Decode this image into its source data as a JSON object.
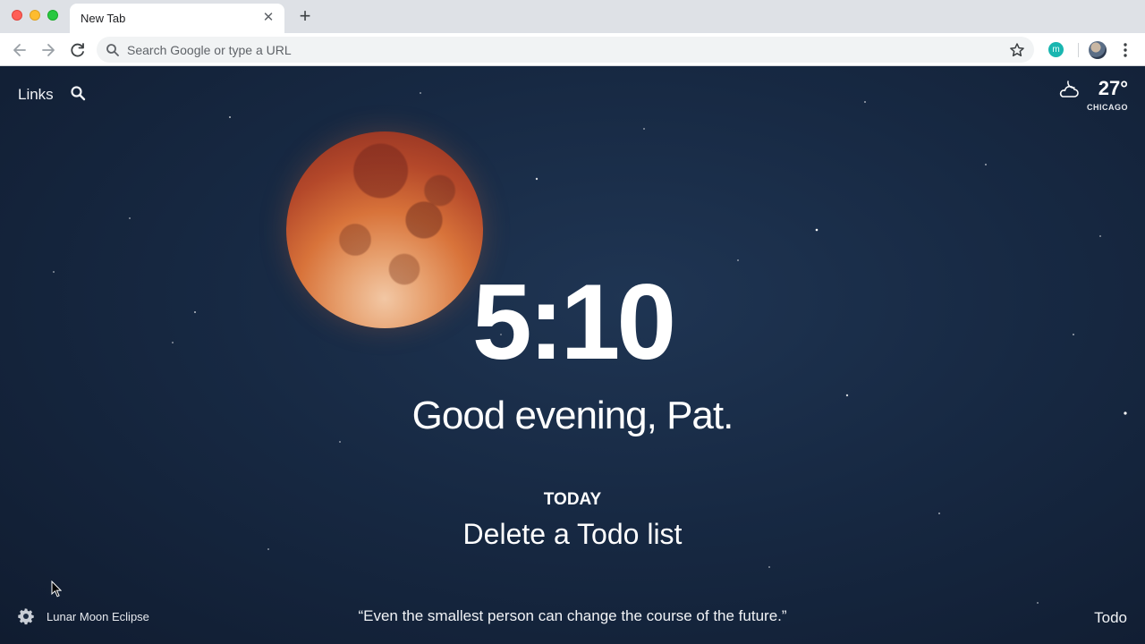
{
  "browser": {
    "tab": {
      "title": "New Tab",
      "close": "✕"
    },
    "new_tab": "+",
    "omnibox": {
      "placeholder": "Search Google or type a URL",
      "value": ""
    },
    "extension": {
      "letter": "m",
      "color": "#19b6b0"
    }
  },
  "dashboard": {
    "links_label": "Links",
    "weather": {
      "temperature": "27°",
      "city": "CHICAGO",
      "icon": "partly-cloudy-night-icon"
    },
    "clock": "5:10",
    "greeting": "Good evening, Pat.",
    "focus": {
      "label": "TODAY",
      "text": "Delete a Todo list"
    },
    "photo_credit": "Lunar Moon Eclipse",
    "quote": "“Even the smallest person can change the course of the future.”",
    "todo_label": "Todo"
  },
  "colors": {
    "sky": "#172943",
    "moon": "#d8733a",
    "text": "#ffffff"
  }
}
